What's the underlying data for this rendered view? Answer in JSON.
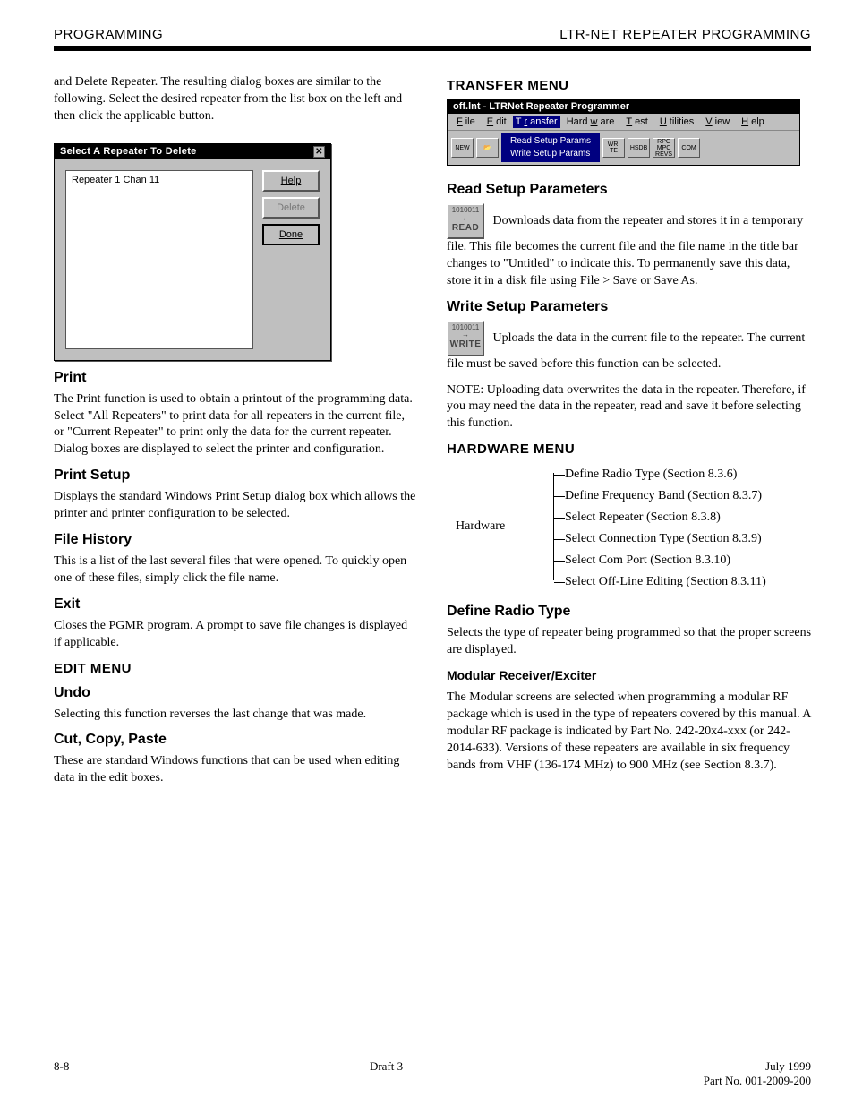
{
  "header": {
    "left": "PROGRAMMING",
    "right": "LTR-NET REPEATER PROGRAMMING"
  },
  "left_col": {
    "lead_text": "and Delete Repeater. The resulting dialog boxes are similar to the following. Select the desired repeater from the list box on the left and then click the applicable button.",
    "dialog": {
      "title": "Select A Repeater To Delete",
      "list_item": "Repeater 1     Chan 11",
      "buttons": {
        "help": "Help",
        "delete": "Delete",
        "done": "Done"
      }
    },
    "print_h": "Print",
    "print_p": "The Print function is used to obtain a printout of the programming data. Select \"All Repeaters\" to print data for all repeaters in the current file, or \"Current Repeater\" to print only the data for the current repeater. Dialog boxes are displayed to select the printer and configuration.",
    "printset_h": "Print Setup",
    "printset_p": "Displays the standard Windows Print Setup dialog box which allows the printer and printer configuration to be selected.",
    "filehist_h": "File History",
    "filehist_p": "This is a list of the last several files that were opened. To quickly open one of these files, simply click the file name.",
    "exit_h": "Exit",
    "exit_p": "Closes the PGMR program. A prompt to save file changes is displayed if applicable.",
    "edit_h": "EDIT MENU",
    "undo_h": "Undo",
    "undo_p": "Selecting this function reverses the last change that was made.",
    "ccp_h": "Cut, Copy, Paste",
    "ccp_p": "These are standard Windows functions that can be used when editing data in the edit boxes."
  },
  "right_col": {
    "transfer_h": "TRANSFER MENU",
    "app": {
      "title": "off.lnt - LTRNet Repeater Programmer",
      "menus": [
        "File",
        "Edit",
        "Transfer",
        "Hardware",
        "Test",
        "Utilities",
        "View",
        "Help"
      ],
      "dropdown": {
        "read": "Read Setup Params",
        "write": "Write Setup Params"
      },
      "toolbar_icons": [
        "NEW",
        "OPEN",
        "",
        "WRITE",
        "HSDB",
        "RPC/MPC REVS",
        "COM"
      ]
    },
    "read_title": "Read Setup Parameters",
    "read_icon_top": "1010011",
    "read_icon_label": "READ",
    "read_p": "Downloads data from the repeater and stores it in a temporary file. This file becomes the current file and the file name in the title bar changes to \"Untitled\" to indicate this. To permanently save this data, store it in a disk file using File > Save or Save As.",
    "write_title": "Write Setup Parameters",
    "write_icon_top": "1010011",
    "write_icon_label": "WRITE",
    "write_p1": "Uploads the data in the current file to the repeater. The current file must be saved before this function can be selected.",
    "write_p2": "NOTE: Uploading data overwrites the data in the repeater. Therefore, if you may need the data in the repeater, read and save it before selecting this function.",
    "hardware_h": "HARDWARE MENU",
    "tree": {
      "root": "Hardware",
      "items": [
        "Define Radio Type (Section 8.3.6)",
        "Define Frequency Band (Section 8.3.7)",
        "Select Repeater (Section 8.3.8)",
        "Select Connection Type (Section 8.3.9)",
        "Select Com Port (Section 8.3.10)",
        "Select Off-Line Editing (Section 8.3.11)"
      ]
    },
    "drt_h": "Define Radio Type",
    "drt_p1": "Selects the type of repeater being programmed so that the proper screens are displayed.",
    "drt_sub": "Modular Receiver/Exciter",
    "drt_p2": "The Modular screens are selected when programming a modular RF package which is used in the type of repeaters covered by this manual. A modular RF package is indicated by Part No. 242-20x4-xxx (or 242-2014-633). Versions of these repeaters are available in six frequency bands from VHF (136-174 MHz) to 900 MHz (see Section 8.3.7)."
  },
  "footer": {
    "left": "8-8",
    "mid": "Draft 3",
    "right": "July 1999\nPart No. 001-2009-200"
  }
}
